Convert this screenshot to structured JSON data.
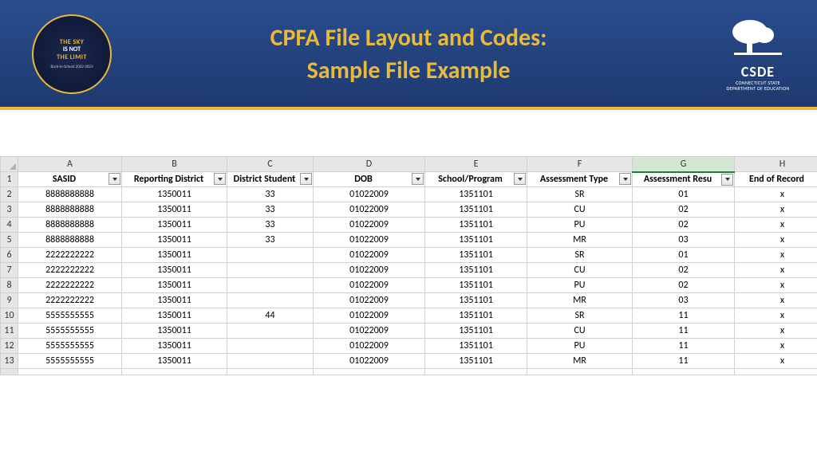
{
  "header": {
    "title_line1": "CPFA File Layout and Codes:",
    "title_line2": "Sample File Example",
    "badge": {
      "line1": "THE SKY",
      "line2": "IS NOT",
      "line3": "THE LIMIT",
      "sub": "Back-to-School 2022-2023"
    },
    "logo": {
      "main": "CSDE",
      "sub1": "CONNECTICUT STATE",
      "sub2": "DEPARTMENT OF EDUCATION"
    }
  },
  "columns_letters": [
    "A",
    "B",
    "C",
    "D",
    "E",
    "F",
    "G",
    "H"
  ],
  "selected_column": "G",
  "headers": [
    "SASID",
    "Reporting District",
    "District Student",
    "DOB",
    "School/Program",
    "Assessment Type",
    "Assessment Resu",
    "End of Record"
  ],
  "rows": [
    {
      "n": 2,
      "c": [
        "8888888888",
        "1350011",
        "33",
        "01022009",
        "1351101",
        "SR",
        "01",
        "x"
      ]
    },
    {
      "n": 3,
      "c": [
        "8888888888",
        "1350011",
        "33",
        "01022009",
        "1351101",
        "CU",
        "02",
        "x"
      ]
    },
    {
      "n": 4,
      "c": [
        "8888888888",
        "1350011",
        "33",
        "01022009",
        "1351101",
        "PU",
        "02",
        "x"
      ]
    },
    {
      "n": 5,
      "c": [
        "8888888888",
        "1350011",
        "33",
        "01022009",
        "1351101",
        "MR",
        "03",
        "x"
      ]
    },
    {
      "n": 6,
      "c": [
        "2222222222",
        "1350011",
        "",
        "01022009",
        "1351101",
        "SR",
        "01",
        "x"
      ]
    },
    {
      "n": 7,
      "c": [
        "2222222222",
        "1350011",
        "",
        "01022009",
        "1351101",
        "CU",
        "02",
        "x"
      ]
    },
    {
      "n": 8,
      "c": [
        "2222222222",
        "1350011",
        "",
        "01022009",
        "1351101",
        "PU",
        "02",
        "x"
      ]
    },
    {
      "n": 9,
      "c": [
        "2222222222",
        "1350011",
        "",
        "01022009",
        "1351101",
        "MR",
        "03",
        "x"
      ]
    },
    {
      "n": 10,
      "c": [
        "5555555555",
        "1350011",
        "44",
        "01022009",
        "1351101",
        "SR",
        "11",
        "x"
      ]
    },
    {
      "n": 11,
      "c": [
        "5555555555",
        "1350011",
        "",
        "01022009",
        "1351101",
        "CU",
        "11",
        "x"
      ]
    },
    {
      "n": 12,
      "c": [
        "5555555555",
        "1350011",
        "",
        "01022009",
        "1351101",
        "PU",
        "11",
        "x"
      ]
    },
    {
      "n": 13,
      "c": [
        "5555555555",
        "1350011",
        "",
        "01022009",
        "1351101",
        "MR",
        "11",
        "x"
      ]
    }
  ]
}
